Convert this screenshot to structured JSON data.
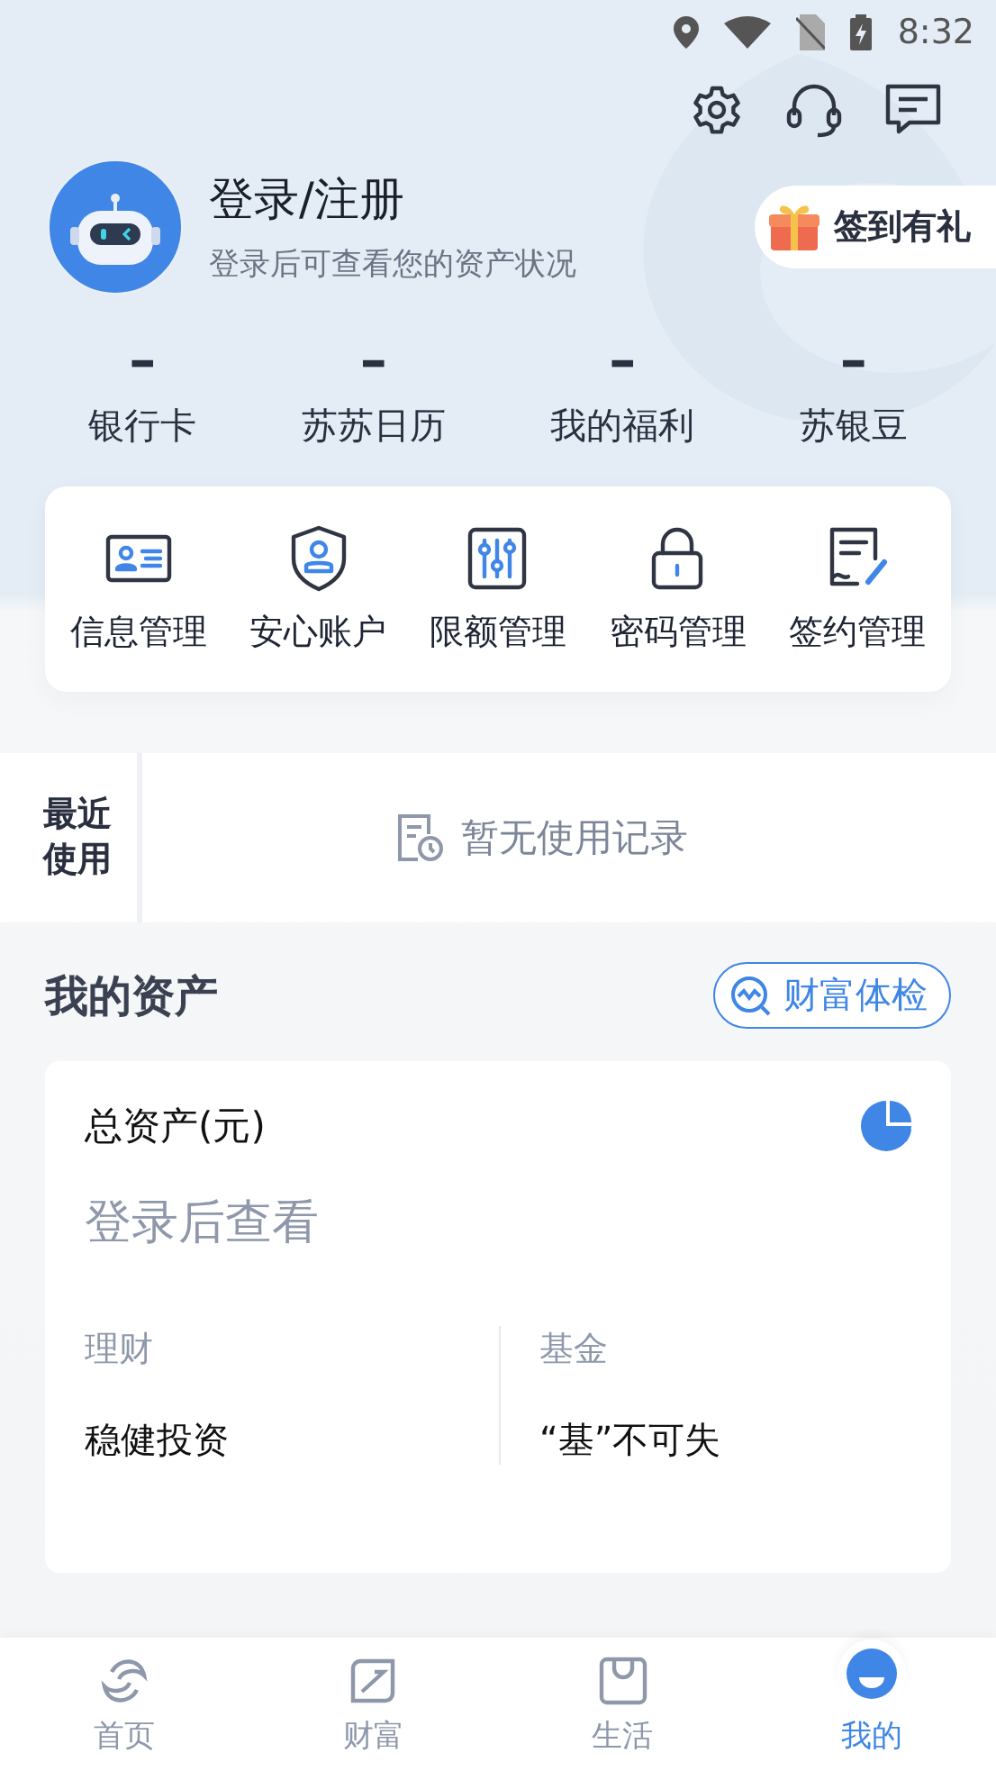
{
  "status_bar": {
    "time": "8:32"
  },
  "header_actions": [
    {
      "kind": "settings"
    },
    {
      "kind": "support"
    },
    {
      "kind": "message"
    }
  ],
  "profile": {
    "title": "登录/注册",
    "subtitle": "登录后可查看您的资产状况",
    "checkin": "签到有礼"
  },
  "stats": [
    {
      "value": "–",
      "label": "银行卡"
    },
    {
      "value": "–",
      "label": "苏苏日历"
    },
    {
      "value": "–",
      "label": "我的福利"
    },
    {
      "value": "–",
      "label": "苏银豆"
    }
  ],
  "quick_actions": [
    {
      "kind": "id-card",
      "label": "信息管理"
    },
    {
      "kind": "shield",
      "label": "安心账户"
    },
    {
      "kind": "sliders",
      "label": "限额管理"
    },
    {
      "kind": "lock",
      "label": "密码管理"
    },
    {
      "kind": "contract",
      "label": "签约管理"
    }
  ],
  "recent": {
    "label": "最近使用",
    "empty_text": "暂无使用记录"
  },
  "assets": {
    "title": "我的资产",
    "checkup_button": "财富体检",
    "total_label": "总资产(元)",
    "total_value": "登录后查看",
    "items": [
      {
        "label": "理财",
        "value": "稳健投资"
      },
      {
        "label": "基金",
        "value": "“基”不可失"
      }
    ]
  },
  "bottom_nav": [
    {
      "kind": "home",
      "label": "首页",
      "selected": false
    },
    {
      "kind": "wealth",
      "label": "财富",
      "selected": false
    },
    {
      "kind": "life",
      "label": "生活",
      "selected": false
    },
    {
      "kind": "mine",
      "label": "我的",
      "selected": true
    }
  ]
}
